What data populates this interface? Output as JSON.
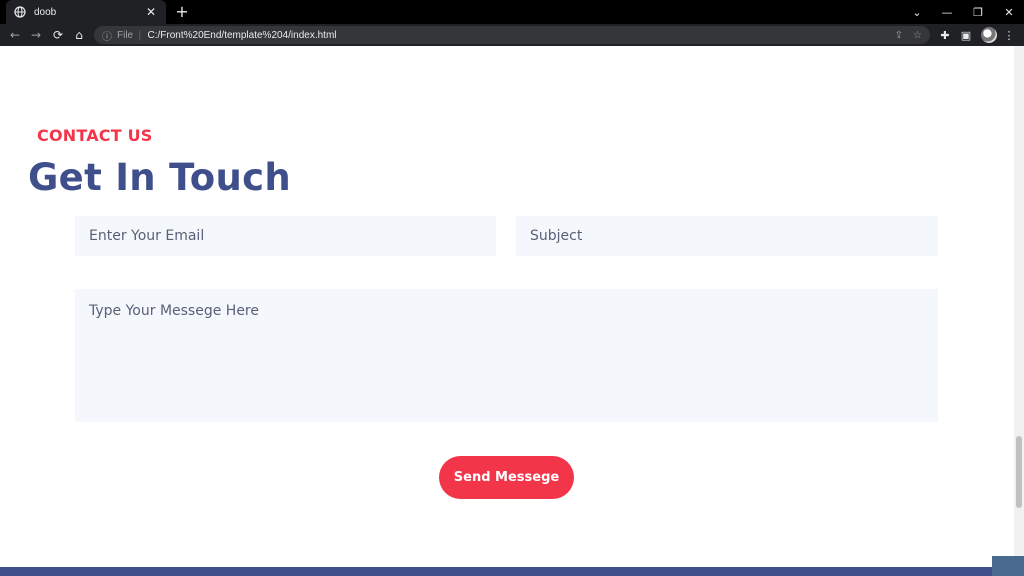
{
  "browser": {
    "tab_title": "doob",
    "tab_close": "✕",
    "new_tab": "+",
    "file_label": "File",
    "url": "C:/Front%20End/template%204/index.html",
    "window_controls": {
      "tab_search": "⌄",
      "minimize": "—",
      "restore": "❐",
      "close": "✕"
    }
  },
  "section": {
    "eyebrow": "CONTACT US",
    "headline": "Get In Touch"
  },
  "form": {
    "email_placeholder": "Enter Your Email",
    "subject_placeholder": "Subject",
    "message_placeholder": "Type Your Messege Here",
    "send_label": "Send Messege"
  },
  "colors": {
    "accent": "#f3354a",
    "heading": "#3e4f8c",
    "field_bg": "#f4f8fc"
  }
}
